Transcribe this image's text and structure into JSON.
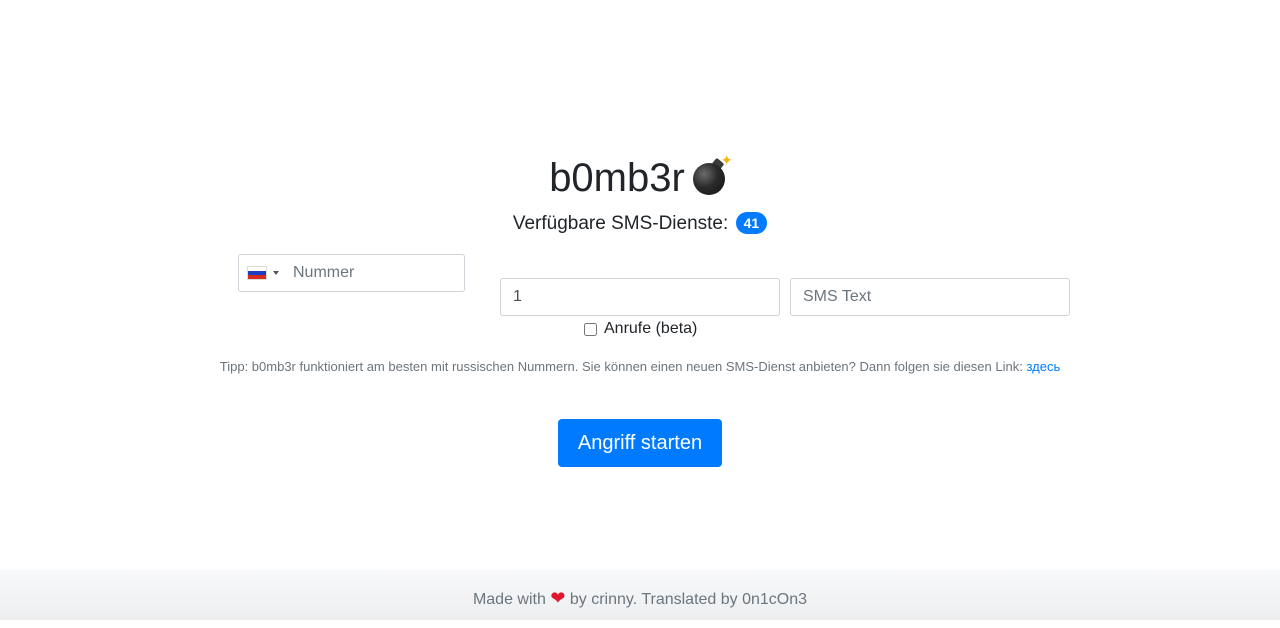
{
  "header": {
    "title": "b0mb3r",
    "title_icon": "bomb-icon",
    "services_label": "Verfügbare SMS-Dienste:",
    "services_count": "41"
  },
  "form": {
    "country_flag": "russia-flag-icon",
    "phone_placeholder": "Nummer",
    "count_value": "1",
    "sms_placeholder": "SMS Text",
    "calls_label": "Anrufe (beta)",
    "calls_checked": false
  },
  "tip": {
    "text": "Tipp: b0mb3r funktioniert am besten mit russischen Nummern. Sie können einen neuen SMS-Dienst anbieten? Dann folgen sie diesen Link: ",
    "link_label": "здесь"
  },
  "actions": {
    "start_label": "Angriff starten"
  },
  "footer": {
    "made_with": "Made with",
    "heart": "❤",
    "credits": "by crinny. Translated by 0n1cOn3"
  },
  "colors": {
    "accent": "#007bff",
    "text": "#212529",
    "muted": "#6c757d",
    "heart": "#e0142c"
  }
}
